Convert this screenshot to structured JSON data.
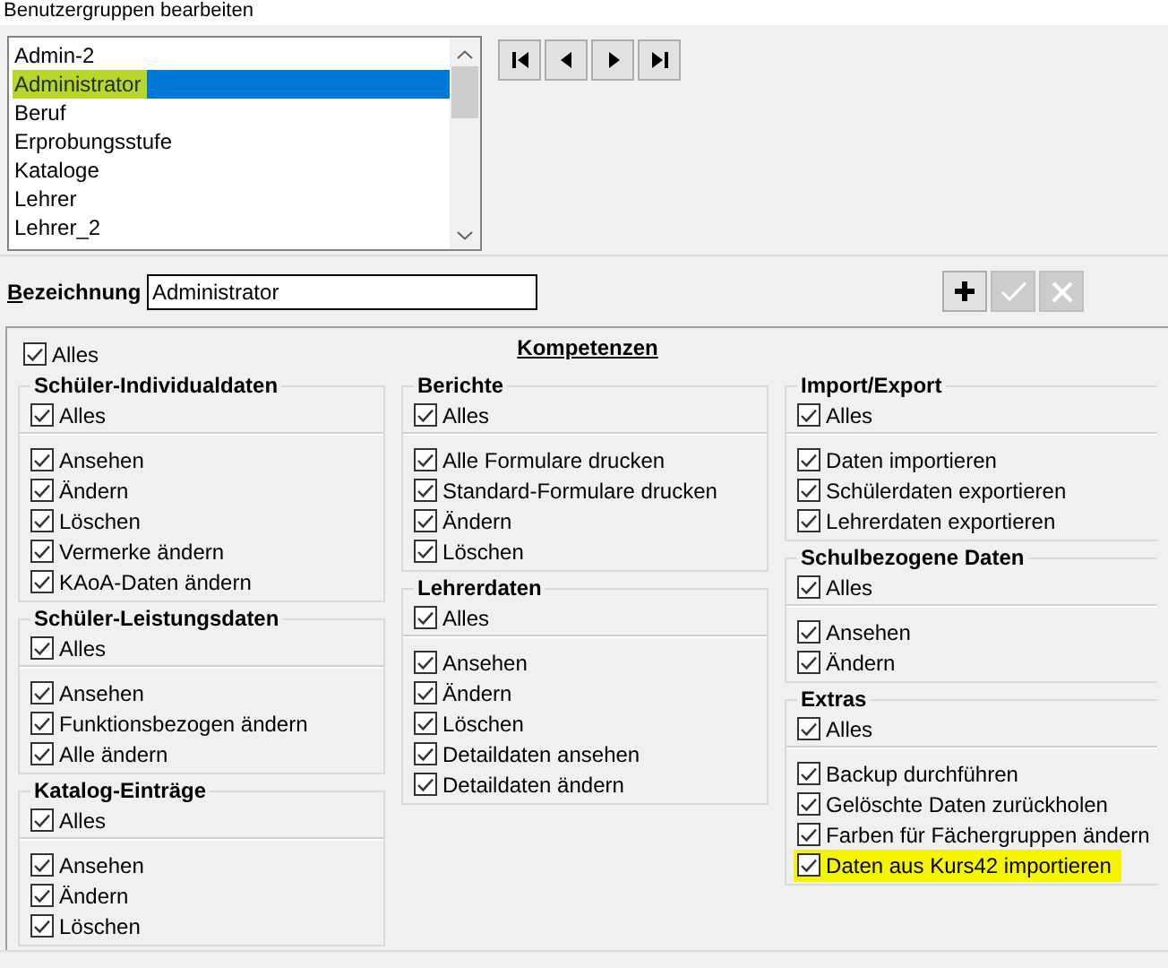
{
  "window": {
    "title": "Benutzergruppen bearbeiten"
  },
  "group_list": {
    "items": [
      {
        "label": "Admin-2",
        "selected": false,
        "highlighted": false
      },
      {
        "label": "Administrator",
        "selected": true,
        "highlighted": true
      },
      {
        "label": "Beruf",
        "selected": false,
        "highlighted": false
      },
      {
        "label": "Erprobungsstufe",
        "selected": false,
        "highlighted": false
      },
      {
        "label": "Kataloge",
        "selected": false,
        "highlighted": false
      },
      {
        "label": "Lehrer",
        "selected": false,
        "highlighted": false
      },
      {
        "label": "Lehrer_2",
        "selected": false,
        "highlighted": false
      }
    ]
  },
  "nav_buttons": [
    {
      "kind": "first"
    },
    {
      "kind": "prev"
    },
    {
      "kind": "next"
    },
    {
      "kind": "last"
    }
  ],
  "name_field": {
    "label": "Bezeichnung",
    "value": "Administrator"
  },
  "actions": [
    {
      "kind": "add",
      "disabled": false
    },
    {
      "kind": "confirm",
      "disabled": true
    },
    {
      "kind": "cancel",
      "disabled": true
    }
  ],
  "competences": {
    "title": "Kompetenzen",
    "all": {
      "label": "Alles",
      "checked": true
    },
    "columns": [
      [
        {
          "title": "Schüler-Individualdaten",
          "all": {
            "label": "Alles",
            "checked": true
          },
          "items": [
            {
              "label": "Ansehen",
              "checked": true
            },
            {
              "label": "Ändern",
              "checked": true
            },
            {
              "label": "Löschen",
              "checked": true
            },
            {
              "label": "Vermerke ändern",
              "checked": true
            },
            {
              "label": "KAoA-Daten ändern",
              "checked": true
            }
          ]
        },
        {
          "title": "Schüler-Leistungsdaten",
          "all": {
            "label": "Alles",
            "checked": true
          },
          "items": [
            {
              "label": "Ansehen",
              "checked": true
            },
            {
              "label": "Funktionsbezogen ändern",
              "checked": true
            },
            {
              "label": "Alle ändern",
              "checked": true
            }
          ]
        },
        {
          "title": "Katalog-Einträge",
          "all": {
            "label": "Alles",
            "checked": true
          },
          "items": [
            {
              "label": "Ansehen",
              "checked": true
            },
            {
              "label": "Ändern",
              "checked": true
            },
            {
              "label": "Löschen",
              "checked": true
            }
          ]
        }
      ],
      [
        {
          "title": "Berichte",
          "all": {
            "label": "Alles",
            "checked": true
          },
          "items": [
            {
              "label": "Alle Formulare drucken",
              "checked": true
            },
            {
              "label": "Standard-Formulare drucken",
              "checked": true
            },
            {
              "label": "Ändern",
              "checked": true
            },
            {
              "label": "Löschen",
              "checked": true
            }
          ]
        },
        {
          "title": "Lehrerdaten",
          "all": {
            "label": "Alles",
            "checked": true
          },
          "items": [
            {
              "label": "Ansehen",
              "checked": true
            },
            {
              "label": "Ändern",
              "checked": true
            },
            {
              "label": "Löschen",
              "checked": true
            },
            {
              "label": "Detaildaten ansehen",
              "checked": true
            },
            {
              "label": "Detaildaten ändern",
              "checked": true
            }
          ]
        }
      ],
      [
        {
          "title": "Import/Export",
          "all": {
            "label": "Alles",
            "checked": true
          },
          "items": [
            {
              "label": "Daten importieren",
              "checked": true
            },
            {
              "label": "Schülerdaten exportieren",
              "checked": true
            },
            {
              "label": "Lehrerdaten exportieren",
              "checked": true
            }
          ]
        },
        {
          "title": "Schulbezogene Daten",
          "all": {
            "label": "Alles",
            "checked": true
          },
          "items": [
            {
              "label": "Ansehen",
              "checked": true
            },
            {
              "label": "Ändern",
              "checked": true
            }
          ]
        },
        {
          "title": "Extras",
          "all": {
            "label": "Alles",
            "checked": true
          },
          "items": [
            {
              "label": "Backup durchführen",
              "checked": true,
              "highlighted": false
            },
            {
              "label": "Gelöschte Daten zurückholen",
              "checked": true,
              "highlighted": false
            },
            {
              "label": "Farben für Fächergruppen ändern",
              "checked": true,
              "highlighted": false
            },
            {
              "label": "Daten aus Kurs42 importieren",
              "checked": true,
              "highlighted": true
            }
          ]
        }
      ]
    ]
  }
}
